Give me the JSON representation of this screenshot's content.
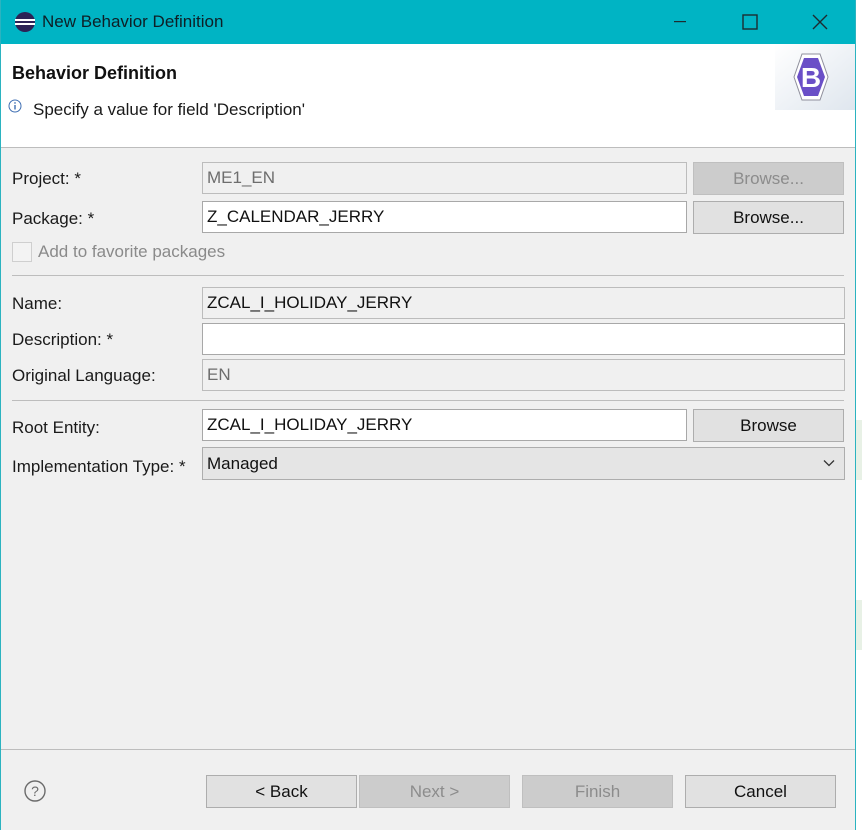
{
  "window": {
    "title": "New Behavior Definition",
    "title_bar_color": "#00b4c4",
    "controls": [
      "minimize-icon",
      "maximize-icon",
      "close-icon"
    ]
  },
  "banner": {
    "title": "Behavior Definition",
    "message": "Specify a value for field 'Description'",
    "message_icon": "info-icon",
    "logo_letter": "B",
    "logo_color": "#6a4fc7"
  },
  "form": {
    "project": {
      "label": "Project: *",
      "value": "ME1_EN",
      "browse_label": "Browse..."
    },
    "package": {
      "label": "Package: *",
      "value": "Z_CALENDAR_JERRY",
      "browse_label": "Browse..."
    },
    "favorite": {
      "label": "Add to favorite packages",
      "checked": false
    },
    "name": {
      "label": "Name:",
      "value": "ZCAL_I_HOLIDAY_JERRY"
    },
    "description": {
      "label": "Description: *",
      "value": ""
    },
    "original_language": {
      "label": "Original Language:",
      "value": "EN"
    },
    "root_entity": {
      "label": "Root Entity:",
      "value": "ZCAL_I_HOLIDAY_JERRY",
      "browse_label": "Browse"
    },
    "implementation_type": {
      "label": "Implementation Type: *",
      "selected": "Managed"
    }
  },
  "footer": {
    "help_icon": "help-icon",
    "back_label": "< Back",
    "next_label": "Next >",
    "finish_label": "Finish",
    "cancel_label": "Cancel"
  }
}
